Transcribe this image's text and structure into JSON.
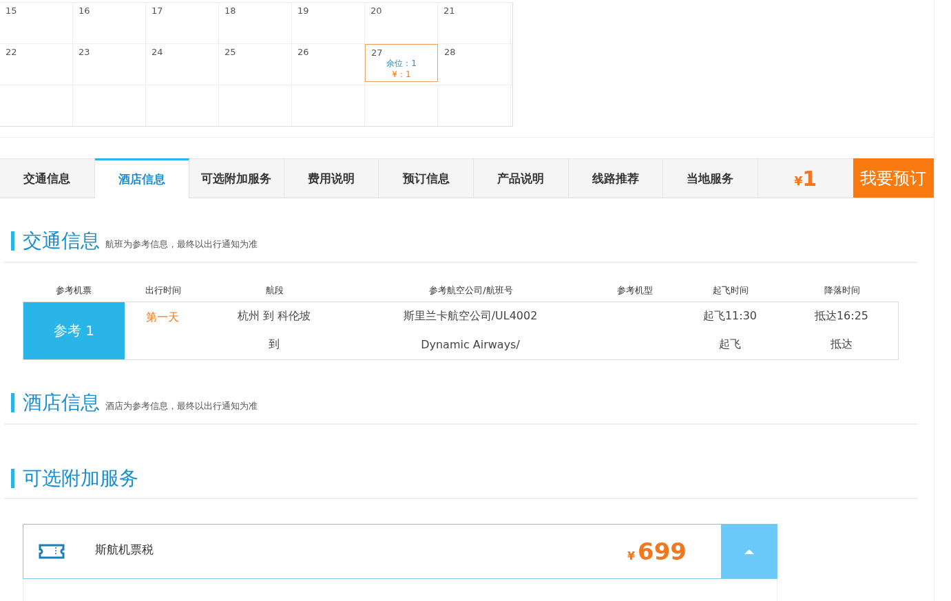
{
  "calendar": {
    "weeks": [
      [
        {
          "day": "15",
          "selected": false
        },
        {
          "day": "16",
          "selected": false
        },
        {
          "day": "17",
          "selected": false
        },
        {
          "day": "18",
          "selected": false
        },
        {
          "day": "19",
          "selected": false
        },
        {
          "day": "20",
          "selected": false
        },
        {
          "day": "21",
          "selected": false
        }
      ],
      [
        {
          "day": "22",
          "selected": false
        },
        {
          "day": "23",
          "selected": false
        },
        {
          "day": "24",
          "selected": false
        },
        {
          "day": "25",
          "selected": false
        },
        {
          "day": "26",
          "selected": false
        },
        {
          "day": "27",
          "selected": true,
          "seats": "余位：1",
          "price": "¥：1"
        },
        {
          "day": "28",
          "selected": false
        }
      ]
    ]
  },
  "tabs": [
    {
      "label": "交通信息",
      "selected": false
    },
    {
      "label": "酒店信息",
      "selected": true
    },
    {
      "label": "可选附加服务",
      "selected": false
    },
    {
      "label": "费用说明",
      "selected": false
    },
    {
      "label": "预订信息",
      "selected": false
    },
    {
      "label": "产品说明",
      "selected": false
    },
    {
      "label": "线路推荐",
      "selected": false
    },
    {
      "label": "当地服务",
      "selected": false
    }
  ],
  "price_tab": {
    "currency": "¥",
    "amount": "1"
  },
  "book_button": "我要预订",
  "transport": {
    "title": "交通信息",
    "note": "航班为参考信息，最终以出行通知为准",
    "columns": [
      "参考机票",
      "出行时间",
      "航段",
      "参考航空公司/航班号",
      "参考机型",
      "起飞时间",
      "降落时间"
    ],
    "rows": [
      {
        "label": "参考 1",
        "day": "第一天",
        "lines": [
          {
            "segment": "杭州 到 科伦坡",
            "airline": "斯里兰卡航空公司/UL4002",
            "depart": "起飞11:30",
            "arrive": "抵达16:25"
          },
          {
            "segment": "到",
            "airline": "Dynamic Airways/",
            "depart": "起飞",
            "arrive": "抵达"
          }
        ]
      }
    ]
  },
  "hotel": {
    "title": "酒店信息",
    "note": "酒店为参考信息，最终以出行通知为准"
  },
  "extras": {
    "title": "可选附加服务",
    "items": [
      {
        "name": "斯航机票税",
        "currency": "¥",
        "price": "699",
        "expanded": true
      }
    ]
  }
}
